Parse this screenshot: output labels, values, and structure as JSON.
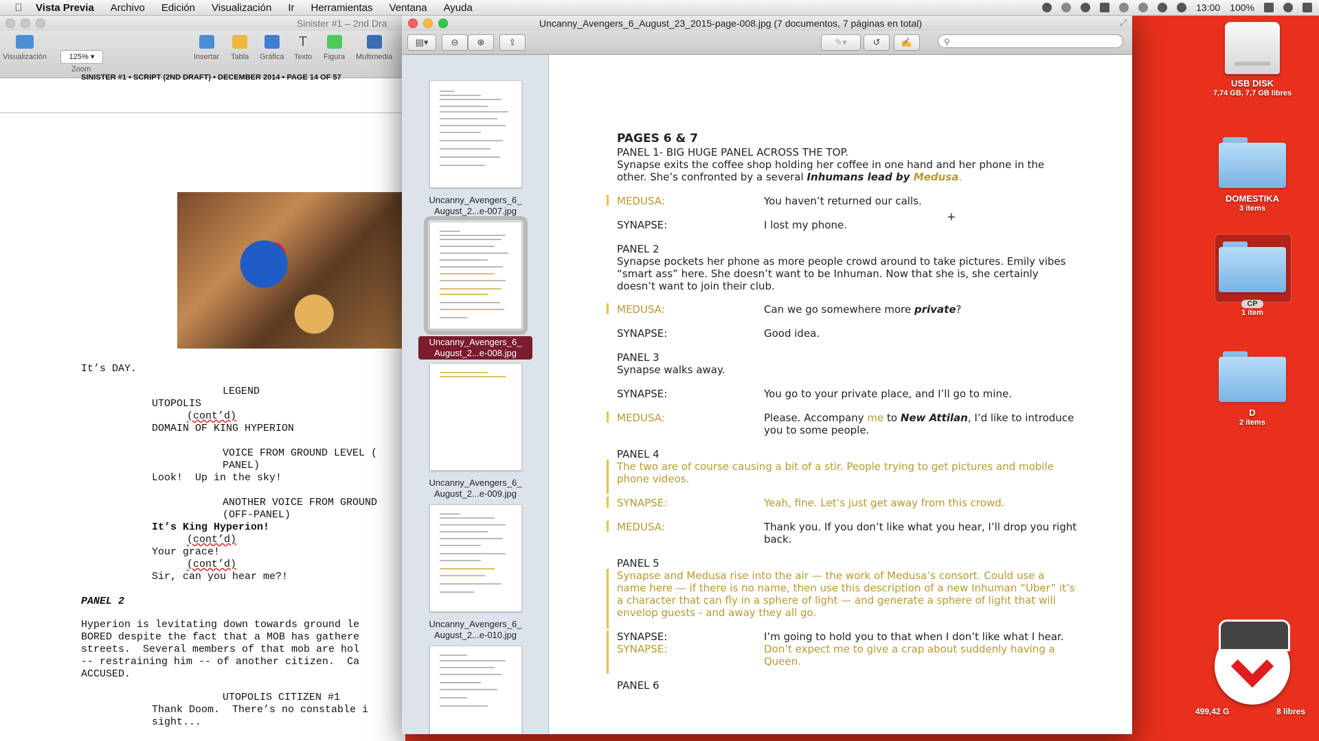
{
  "menubar": {
    "app": "Vista Previa",
    "items": [
      "Archivo",
      "Edición",
      "Visualización",
      "Ir",
      "Herramientas",
      "Ventana",
      "Ayuda"
    ],
    "time": "13:00",
    "battery": "100%"
  },
  "desktop": {
    "usb": {
      "name": "USB DISK",
      "sub": "7,74 GB, 7,7 GB libres"
    },
    "domestika": {
      "name": "DOMESTIKA",
      "sub": "3 items"
    },
    "cp": {
      "name": "CP",
      "sub": "1 item"
    },
    "d": {
      "name": "D",
      "sub": "2 items"
    },
    "bottom_left": "499,42 G",
    "bottom_right": "8 libres"
  },
  "pages_window": {
    "title": "Sinister #1 – 2nd Dra",
    "toolbar": {
      "visualizacion": "Visualización",
      "zoom_value": "125%",
      "zoom": "Zoom",
      "insertar": "Insertar",
      "tabla": "Tabla",
      "grafica": "Gráfica",
      "texto": "Texto",
      "figura": "Figura",
      "multimedia": "Multimedia"
    },
    "header": "SINISTER #1 • SCRIPT (2ND DRAFT) • DECEMBER 2014 • PAGE 14 OF 57",
    "lines": [
      "It’s DAY.",
      "LEGEND",
      "UTOPOLIS",
      "(cont’d)",
      "DOMAIN OF KING HYPERION",
      "VOICE FROM GROUND LEVEL (",
      "PANEL)",
      "Look!  Up in the sky!",
      "ANOTHER VOICE FROM GROUND",
      "(OFF-PANEL)",
      "It’s King Hyperion!",
      "(cont’d)",
      "Your grace!",
      "(cont’d)",
      "Sir, can you hear me?!",
      "PANEL 2",
      "Hyperion is levitating down towards ground le",
      "BORED despite the fact that a MOB has gathere",
      "streets.  Several members of that mob are hol",
      "-- restraining him -- of another citizen.  Ca",
      "ACCUSED.",
      "UTOPOLIS CITIZEN #1",
      "Thank Doom.  There’s no constable i",
      "sight..."
    ]
  },
  "preview": {
    "title": "Uncanny_Avengers_6_August_23_2015-page-008.jpg (7 documentos, 7 páginas en total)",
    "search_placeholder": "",
    "thumbs": [
      {
        "label": "Uncanny_Avengers_6_ August_2...e-007.jpg",
        "selected": false
      },
      {
        "label": "Uncanny_Avengers_6_ August_2...e-008.jpg",
        "selected": true
      },
      {
        "label": "Uncanny_Avengers_6_ August_2...e-009.jpg",
        "selected": false
      },
      {
        "label": "Uncanny_Avengers_6_ August_2...e-010.jpg",
        "selected": false
      },
      {
        "label": "",
        "selected": false
      }
    ],
    "doc": {
      "heading": "PAGES 6 & 7",
      "p1_title": "PANEL 1- BIG HUGE PANEL ACROSS THE TOP.",
      "p1_text_a": "Synapse exits the coffee shop holding her coffee in one hand and her phone in the",
      "p1_text_b": "other. She’s confronted by a several ",
      "p1_bold": "Inhumans lead by ",
      "p1_medusa": "Medusa",
      "p1_end": ".",
      "medusa": "MEDUSA:",
      "synapse": "SYNAPSE:",
      "d1": "You haven’t returned our calls.",
      "d2": "I lost my phone.",
      "p2_title": "PANEL 2",
      "p2_a": "Synapse pockets her phone as more people crowd around to take pictures. Emily vibes",
      "p2_b": "“smart ass” here. She doesn’t want to be Inhuman. Now that she is, she certainly",
      "p2_c": "doesn’t want to join their club.",
      "d3a": "Can we go somewhere more ",
      "d3b": "private",
      "d3c": "?",
      "d4": "Good idea.",
      "p3_title": "PANEL 3",
      "p3_a": "Synapse walks away.",
      "d5": "You go to your private place, and I’ll go to mine.",
      "d6a": "Please. Accompany ",
      "d6me": "me",
      "d6b": " to ",
      "d6c": "New Attilan",
      "d6d": ", I’d like to introduce",
      "d6e": "you to some people.",
      "p4_title": "PANEL 4",
      "p4_a": "The two are of course causing a bit of a stir. People trying to get pictures and mobile",
      "p4_b": "phone videos.",
      "d7": "Yeah, fine. Let’s just get away from this crowd.",
      "d8a": "Thank you. If you don’t like what you hear, I’ll drop you right",
      "d8b": "back.",
      "p5_title": "PANEL 5",
      "p5_a": "Synapse and Medusa rise into the air — the work of Medusa’s consort. Could use a",
      "p5_b": "name here — if there is no name, then use this description of a new Inhuman “Uber” it’s",
      "p5_c": "a character that can fly in a sphere of light — and generate a sphere of light that will",
      "p5_d": "envelop guests - and away they all go.",
      "d9": "I’m going to hold you to that when I don’t like what I hear.",
      "d10a": "Don’t expect me to give a crap about suddenly having a",
      "d10b": "Queen.",
      "p6_title": "PANEL 6"
    }
  }
}
